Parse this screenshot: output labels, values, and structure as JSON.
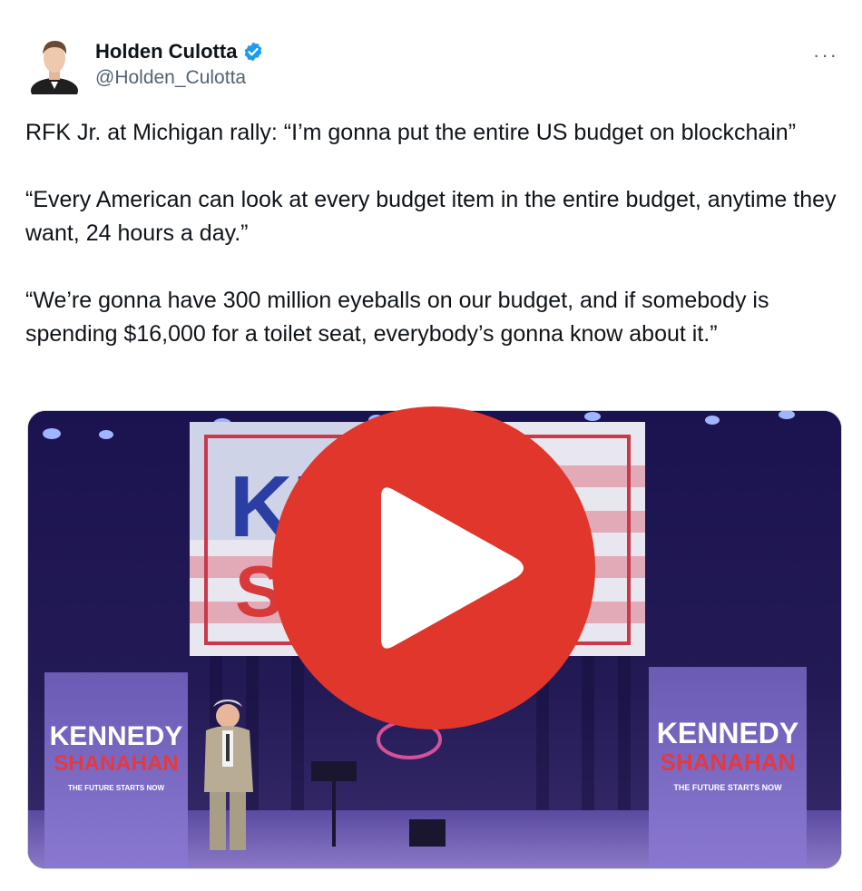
{
  "author": {
    "name": "Holden Culotta",
    "handle": "@Holden_Culotta",
    "verified": true,
    "verified_color": "#1d9bf0"
  },
  "menu": {
    "more_label": "···"
  },
  "tweet": {
    "paragraphs": [
      "RFK Jr. at Michigan rally: “I’m gonna put the entire US budget on blockchain”",
      "“Every American can look at every budget item in the entire budget, anytime they want, 24 hours a day.”",
      "“We’re gonna have 300 million eyeballs on our budget, and if somebody is spending $16,000 for a toilet seat, everybody’s gonna know about it.”"
    ]
  },
  "video": {
    "banner_left_1": "KENNEDY",
    "banner_left_2": "SHANAHAN",
    "banner_left_3": "THE FUTURE STARTS NOW",
    "banner_right_1": "KENNEDY",
    "banner_right_2": "SHANAHAN",
    "banner_right_3": "THE FUTURE STARTS NOW",
    "screen_text_1": "KE",
    "screen_text_2": "S",
    "play_color": "#e0362b"
  }
}
